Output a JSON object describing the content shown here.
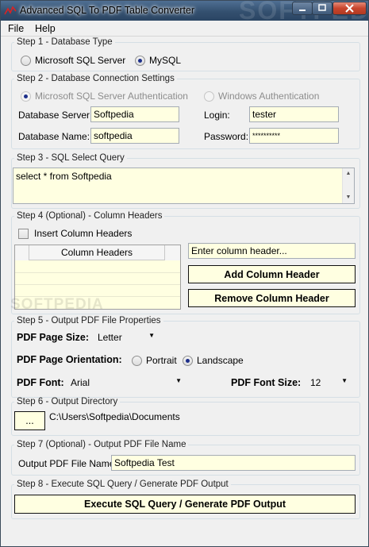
{
  "window": {
    "title": "Advanced SQL To PDF Table Converter",
    "watermark": "SOFTPEDIA"
  },
  "menu": {
    "file": "File",
    "help": "Help"
  },
  "step1": {
    "legend": "Step 1 - Database Type",
    "mssql": "Microsoft SQL Server",
    "mysql": "MySQL",
    "selected": "MySQL"
  },
  "step2": {
    "legend": "Step 2 - Database Connection Settings",
    "sql_auth": "Microsoft SQL Server Authentication",
    "win_auth": "Windows Authentication",
    "server_label": "Database Server:",
    "server_value": "Softpedia",
    "login_label": "Login:",
    "login_value": "tester",
    "dbname_label": "Database Name:",
    "dbname_value": "softpedia",
    "password_label": "Password:",
    "password_value": "**********"
  },
  "step3": {
    "legend": "Step 3 - SQL Select Query",
    "query": "select * from Softpedia"
  },
  "step4": {
    "legend": "Step 4 (Optional) - Column Headers",
    "insert_label": "Insert Column Headers",
    "grid_header": "Column Headers",
    "header_input_value": "Enter column header...",
    "add_button": "Add Column Header",
    "remove_button": "Remove Column Header"
  },
  "step5": {
    "legend": "Step 5 - Output PDF File Properties",
    "page_size_label": "PDF Page Size:",
    "page_size_value": "Letter",
    "orientation_label": "PDF Page Orientation:",
    "portrait": "Portrait",
    "landscape": "Landscape",
    "orientation_selected": "Landscape",
    "font_label": "PDF Font:",
    "font_value": "Arial",
    "font_size_label": "PDF Font Size:",
    "font_size_value": "12"
  },
  "step6": {
    "legend": "Step 6 - Output Directory",
    "browse": "...",
    "path": "C:\\Users\\Softpedia\\Documents"
  },
  "step7": {
    "legend": "Step 7 (Optional) - Output PDF File Name",
    "label": "Output PDF File Name:",
    "value": "Softpedia Test"
  },
  "step8": {
    "legend": "Step 8 - Execute SQL Query / Generate PDF Output",
    "button": "Execute SQL Query / Generate PDF Output"
  },
  "icons": {
    "app": "app-logo-icon",
    "dropdown": "chevron-down-icon",
    "scroll_up": "scroll-up-arrow-icon",
    "scroll_down": "scroll-down-arrow-icon"
  },
  "colors": {
    "field_background": "#ffffe1",
    "window_background": "#f0f0f0",
    "titlebar": "#3d5a7c",
    "close_button": "#c8452d"
  }
}
